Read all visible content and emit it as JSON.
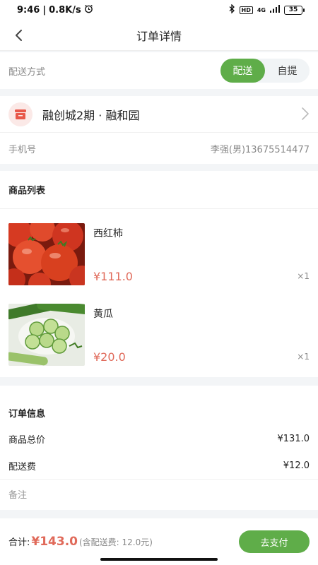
{
  "status_bar": {
    "time": "9:46",
    "speed": "0.8K/s",
    "separator": "|",
    "network": "4G",
    "hd": "HD",
    "battery": "35"
  },
  "nav": {
    "title": "订单详情",
    "back_icon": "chevron-left-icon"
  },
  "delivery": {
    "label": "配送方式",
    "options": [
      "配送",
      "自提"
    ],
    "selected": "配送",
    "accent_color": "#5fad49"
  },
  "address": {
    "icon": "store-icon",
    "name": "融创城2期 · 融和园",
    "phone_label": "手机号",
    "phone_value": "李强(男)13675514477"
  },
  "goods": {
    "header": "商品列表",
    "items": [
      {
        "name": "西红柿",
        "price": "¥111.0",
        "qty": "×1",
        "image": "tomato-image"
      },
      {
        "name": "黄瓜",
        "price": "¥20.0",
        "qty": "×1",
        "image": "cucumber-image"
      }
    ],
    "price_color": "#e06a5a"
  },
  "order_info": {
    "header": "订单信息",
    "subtotal_label": "商品总价",
    "subtotal_value": "¥131.0",
    "delivery_fee_label": "配送费",
    "delivery_fee_value": "¥12.0",
    "note_placeholder": "备注"
  },
  "footer": {
    "total_label": "合计:",
    "total_amount": "¥143.0",
    "total_sub": "(含配送费: 12.0元)",
    "pay_label": "去支付"
  }
}
